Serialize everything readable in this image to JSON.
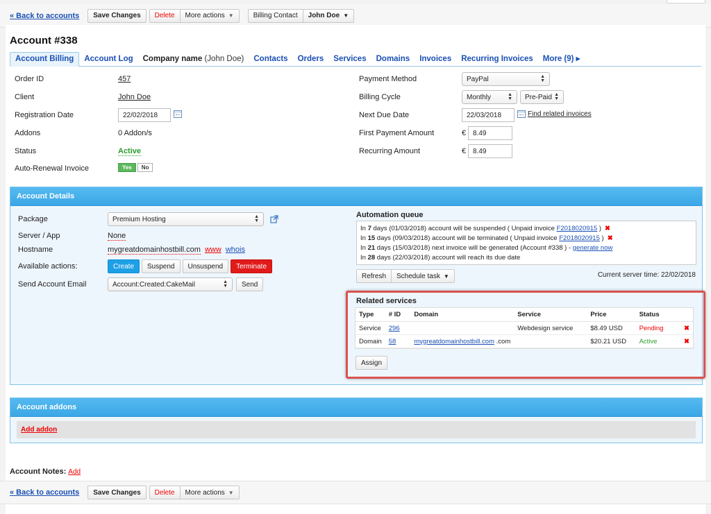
{
  "toolbar": {
    "back": "« Back to accounts",
    "save": "Save Changes",
    "delete": "Delete",
    "more": "More actions",
    "billing_contact": "Billing Contact",
    "contact_name": "John Doe"
  },
  "account": {
    "title": "Account #338"
  },
  "tabs": {
    "billing": "Account Billing",
    "log": "Account Log",
    "company_label": "Company name",
    "company_sub": "(John Doe)",
    "contacts": "Contacts",
    "orders": "Orders",
    "services": "Services",
    "domains": "Domains",
    "invoices": "Invoices",
    "recurring": "Recurring Invoices",
    "more": "More (9) ▸"
  },
  "billing": {
    "order_id_label": "Order ID",
    "order_id": "457",
    "client_label": "Client",
    "client": "John Doe",
    "reg_date_label": "Registration Date",
    "reg_date": "22/02/2018",
    "addons_label": "Addons",
    "addons": "0 Addon/s",
    "status_label": "Status",
    "status": "Active",
    "auto_renew_label": "Auto-Renewal Invoice",
    "yes": "Yes",
    "no": "No",
    "payment_method_label": "Payment Method",
    "payment_method": "PayPal",
    "billing_cycle_label": "Billing Cycle",
    "billing_cycle": "Monthly",
    "billing_type": "Pre-Paid",
    "next_due_label": "Next Due Date",
    "next_due": "22/03/2018",
    "find_invoices": "Find related invoices",
    "first_payment_label": "First Payment Amount",
    "currency": "€",
    "first_payment": "8.49",
    "recurring_label": "Recurring Amount",
    "recurring": "8.49"
  },
  "details": {
    "title": "Account Details",
    "package_label": "Package",
    "package": "Premium Hosting",
    "server_label": "Server / App",
    "server": "None",
    "hostname_label": "Hostname",
    "hostname": "mygreatdomainhostbill.com",
    "www": "www",
    "whois": "whois",
    "actions_label": "Available actions:",
    "create": "Create",
    "suspend": "Suspend",
    "unsuspend": "Unsuspend",
    "terminate": "Terminate",
    "email_label": "Send Account Email",
    "email_template": "Account:Created:CakeMail",
    "send": "Send"
  },
  "queue": {
    "title": "Automation queue",
    "items": [
      {
        "pre": "In ",
        "days": "7",
        "text": " days (01/03/2018) account will be suspended ( Unpaid invoice ",
        "link": "F2018020915",
        "post": " )",
        "remove": "✖"
      },
      {
        "pre": "In ",
        "days": "15",
        "text": " days (09/03/2018) account will be terminated ( Unpaid invoice ",
        "link": "F2018020915",
        "post": " )",
        "remove": "✖"
      },
      {
        "pre": "In ",
        "days": "21",
        "text": " days (15/03/2018) next invoice will be generated (Account #338 ) - ",
        "link": "generate now",
        "post": "",
        "remove": ""
      },
      {
        "pre": "In ",
        "days": "28",
        "text": " days (22/03/2018) account will reach its due date",
        "link": "",
        "post": "",
        "remove": ""
      }
    ],
    "refresh": "Refresh",
    "schedule": "Schedule task",
    "server_time": "Current server time: 22/02/2018"
  },
  "related": {
    "title": "Related services",
    "headers": [
      "Type",
      "# ID",
      "Domain",
      "Service",
      "Price",
      "Status"
    ],
    "rows": [
      {
        "type": "Service",
        "id": "296",
        "domain": "",
        "domain_suffix": "",
        "service": "Webdesign service",
        "price": "$8.49 USD",
        "status": "Pending",
        "remove": "✖"
      },
      {
        "type": "Domain",
        "id": "58",
        "domain": "mygreatdomainhostbill.com",
        "domain_suffix": " .com",
        "service": "",
        "price": "$20.21 USD",
        "status": "Active",
        "remove": "✖"
      }
    ],
    "assign": "Assign"
  },
  "addons": {
    "title": "Account addons",
    "add": "Add addon"
  },
  "notes": {
    "label": "Account Notes:",
    "add": "Add"
  },
  "colors": {
    "accent": "#3aa7e6",
    "danger": "#e11a1a",
    "success": "#2a9d2a",
    "link": "#1a4fb4"
  }
}
